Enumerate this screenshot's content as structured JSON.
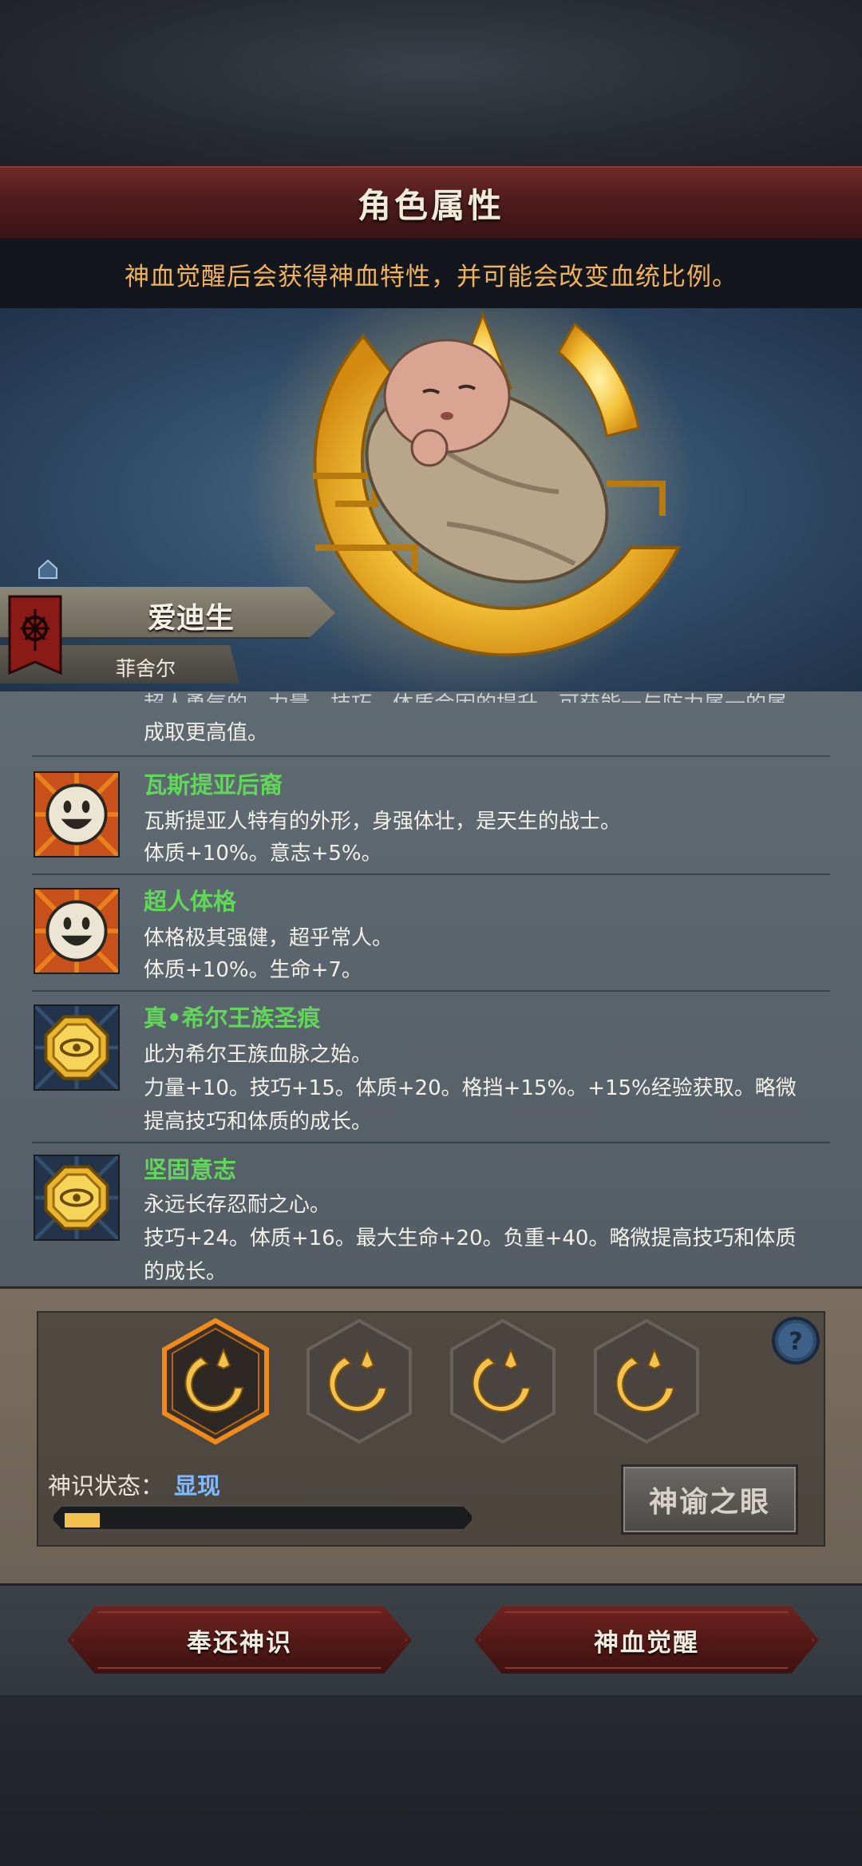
{
  "header": {
    "title": "角色属性"
  },
  "info": {
    "text": "神血觉醒后会获得神血特性，并可能会改变血统比例。"
  },
  "character": {
    "name": "爱迪生",
    "family": "菲舍尔",
    "banner_icon": "house-banner-icon"
  },
  "traits_cut_text": [
    "超人勇气的，力量、技巧、体质会因的提升，可获能一与防力属一的属",
    "成取更高值。"
  ],
  "traits": [
    {
      "name": "瓦斯提亚后裔",
      "icon": "smiley-face-icon",
      "lines": [
        "瓦斯提亚人特有的外形，身强体壮，是天生的战士。",
        "体质+10%。意志+5%。"
      ]
    },
    {
      "name": "超人体格",
      "icon": "smiley-face-icon",
      "lines": [
        "体格极其强健，超乎常人。",
        "体质+10%。生命+7。"
      ]
    },
    {
      "name": "真•希尔王族圣痕",
      "icon": "golden-emblem-icon",
      "lines": [
        "此为希尔王族血脉之始。",
        "力量+10。技巧+15。体质+20。格挡+15%。+15%经验获取。略微",
        "提高技巧和体质的成长。"
      ]
    },
    {
      "name": "坚固意志",
      "icon": "golden-emblem-icon",
      "lines": [
        "永远长存忍耐之心。",
        "技巧+24。体质+16。最大生命+20。负重+40。略微提高技巧和体质",
        "的成长。"
      ]
    }
  ],
  "god_panel": {
    "slots": [
      "divine-sigil-icon",
      "divine-sigil-icon",
      "divine-sigil-icon",
      "divine-sigil-icon"
    ],
    "selected_slot": 0,
    "status_label": "神识状态：",
    "status_value": "显现",
    "progress": 0.09,
    "oracle_button": "神谕之眼"
  },
  "actions": {
    "return_label": "奉还神识",
    "awaken_label": "神血觉醒"
  },
  "colors": {
    "accent_gold": "#f2c14e",
    "trait_green": "#62d65a",
    "status_blue": "#7fb9ff",
    "info_orange": "#f0b25a"
  }
}
